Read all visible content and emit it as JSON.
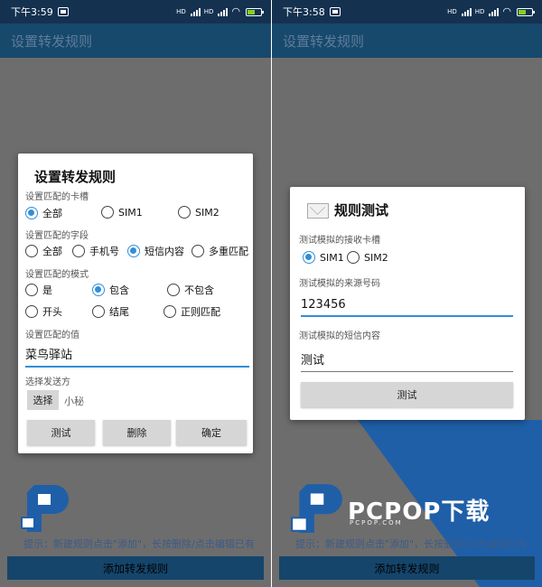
{
  "left": {
    "status_time": "下午3:59",
    "status_hd": "HD",
    "app_title": "设置转发规则",
    "dialog": {
      "title": "设置转发规则",
      "card_label": "设置匹配的卡槽",
      "card_options": [
        "全部",
        "SIM1",
        "SIM2"
      ],
      "card_selected": "全部",
      "field_label": "设置匹配的字段",
      "field_options": [
        "全部",
        "手机号",
        "短信内容",
        "多重匹配"
      ],
      "field_selected": "短信内容",
      "mode_label": "设置匹配的模式",
      "mode_options_row1": [
        "是",
        "包含",
        "不包含"
      ],
      "mode_options_row2": [
        "开头",
        "结尾",
        "正则匹配"
      ],
      "mode_selected": "包含",
      "value_label": "设置匹配的值",
      "value": "菜鸟驿站",
      "sender_label": "选择发送方",
      "choose_btn": "选择",
      "sender_name": "小秘",
      "btn_test": "测试",
      "btn_delete": "删除",
      "btn_ok": "确定"
    },
    "hint": "提示：新建规则点击\"添加\"，长按删除/点击编辑已有",
    "add_button": "添加转发规则"
  },
  "right": {
    "status_time": "下午3:58",
    "status_hd": "HD",
    "app_title": "设置转发规则",
    "dialog": {
      "title": "规则测试",
      "card_label": "测试模拟的接收卡槽",
      "card_options": [
        "SIM1",
        "SIM2"
      ],
      "card_selected": "SIM1",
      "from_label": "测试模拟的来源号码",
      "from_value": "123456",
      "content_label": "测试模拟的短信内容",
      "content_value": "测试",
      "btn_test": "测试"
    },
    "hint": "提示：新建规则点击\"添加\"，长按删除/点击编辑已有",
    "add_button": "添加转发规则"
  },
  "watermark": {
    "brand": "PCPOP下载",
    "sub": "PCPOP.COM"
  },
  "colors": {
    "statusbar": "#143150",
    "appbar": "#17496d",
    "accent": "#2f8fd8",
    "overlay": "#6d6d6d",
    "brand_blue": "#1f5fa8"
  }
}
